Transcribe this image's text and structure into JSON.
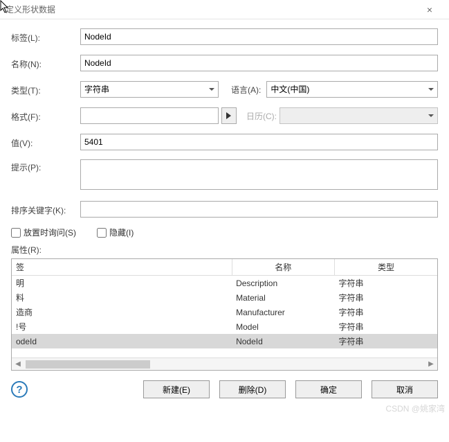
{
  "window": {
    "title": "定义形状数据"
  },
  "labels": {
    "label": "标签(L):",
    "name": "名称(N):",
    "type": "类型(T):",
    "language": "语言(A):",
    "format": "格式(F):",
    "calendar": "日历(C):",
    "value": "值(V):",
    "prompt": "提示(P):",
    "sortkey": "排序关键字(K):",
    "askOnDrop": "放置时询问(S)",
    "hidden": "隐藏(I)",
    "attributes": "属性(R):"
  },
  "fields": {
    "label": "NodeId",
    "name": "NodeId",
    "type": "字符串",
    "language": "中文(中国)",
    "format": "",
    "calendar": "",
    "value": "5401",
    "prompt": "",
    "sortkey": "",
    "askOnDrop": false,
    "hidden": false
  },
  "table": {
    "headers": {
      "label": "签",
      "name": "名称",
      "type": "类型"
    },
    "rows": [
      {
        "label": "明",
        "name": "Description",
        "type": "字符串",
        "selected": false
      },
      {
        "label": "料",
        "name": "Material",
        "type": "字符串",
        "selected": false
      },
      {
        "label": "造商",
        "name": "Manufacturer",
        "type": "字符串",
        "selected": false
      },
      {
        "label": "!号",
        "name": "Model",
        "type": "字符串",
        "selected": false
      },
      {
        "label": "odeId",
        "name": "NodeId",
        "type": "字符串",
        "selected": true
      }
    ]
  },
  "buttons": {
    "new": "新建(E)",
    "delete": "删除(D)",
    "ok": "确定",
    "cancel": "取消"
  },
  "watermark": "CSDN @姚家湾"
}
